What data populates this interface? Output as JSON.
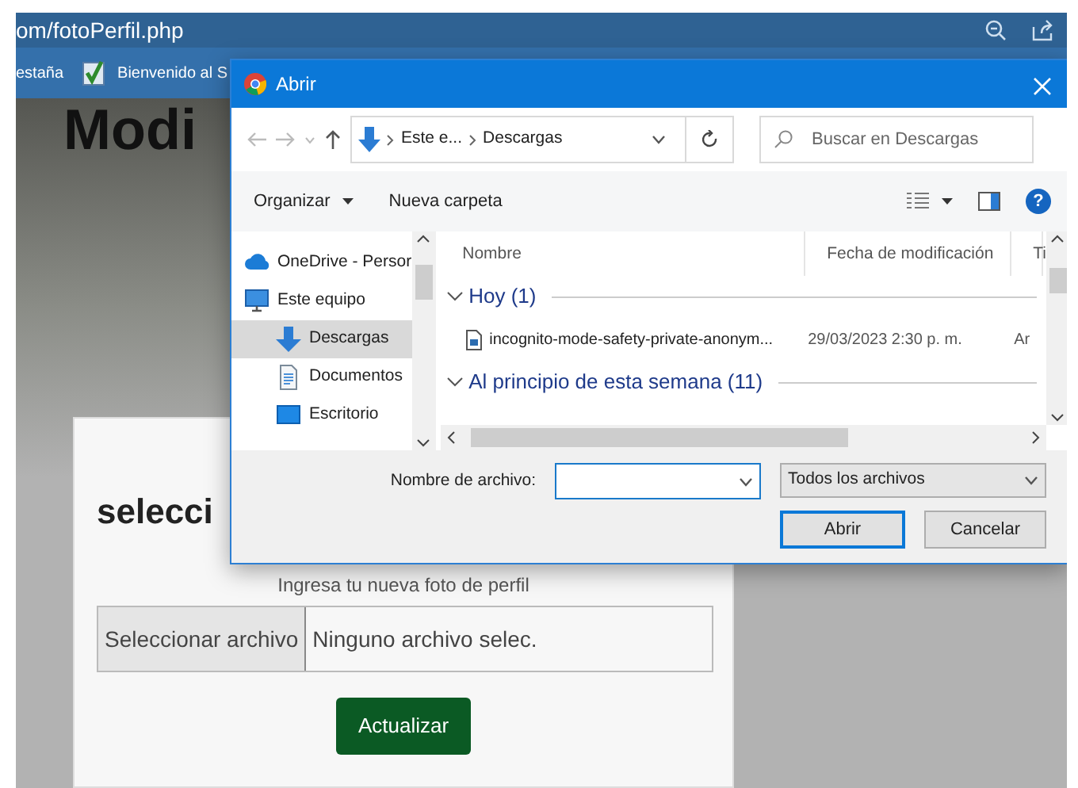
{
  "browser": {
    "url": "om/fotoPerfil.php",
    "bookmarks": [
      {
        "label": "estaña",
        "kind": "plain"
      },
      {
        "label": "Bienvenido al S",
        "kind": "check"
      }
    ]
  },
  "page": {
    "heading": "Modi",
    "card": {
      "heading": "selecci",
      "label": "Ingresa tu nueva foto de perfil",
      "file_button": "Seleccionar archivo",
      "file_status": "Ninguno archivo selec.",
      "submit": "Actualizar"
    }
  },
  "dialog": {
    "title": "Abrir",
    "breadcrumb": [
      "Este e...",
      "Descargas"
    ],
    "search_placeholder": "Buscar en Descargas",
    "organize": "Organizar",
    "new_folder": "Nueva carpeta",
    "help": "?",
    "nav_pane": [
      {
        "label": "OneDrive - Persor",
        "kind": "cloud",
        "selected": false
      },
      {
        "label": "Este equipo",
        "kind": "computer",
        "selected": false,
        "children": [
          {
            "label": "Descargas",
            "kind": "download",
            "selected": true
          },
          {
            "label": "Documentos",
            "kind": "document",
            "selected": false
          },
          {
            "label": "Escritorio",
            "kind": "desktop",
            "selected": false
          }
        ]
      }
    ],
    "columns": [
      "Nombre",
      "Fecha de modificación",
      "Ti"
    ],
    "groups": [
      {
        "label": "Hoy (1)",
        "files": [
          {
            "name": "incognito-mode-safety-private-anonym...",
            "date": "29/03/2023 2:30 p. m.",
            "type": "Ar"
          }
        ]
      },
      {
        "label": "Al principio de esta semana (11)"
      }
    ],
    "filename_label": "Nombre de archivo:",
    "filetype": "Todos los archivos",
    "buttons": [
      {
        "label": "Abrir",
        "default": true
      },
      {
        "label": "Cancelar",
        "default": false
      }
    ]
  }
}
